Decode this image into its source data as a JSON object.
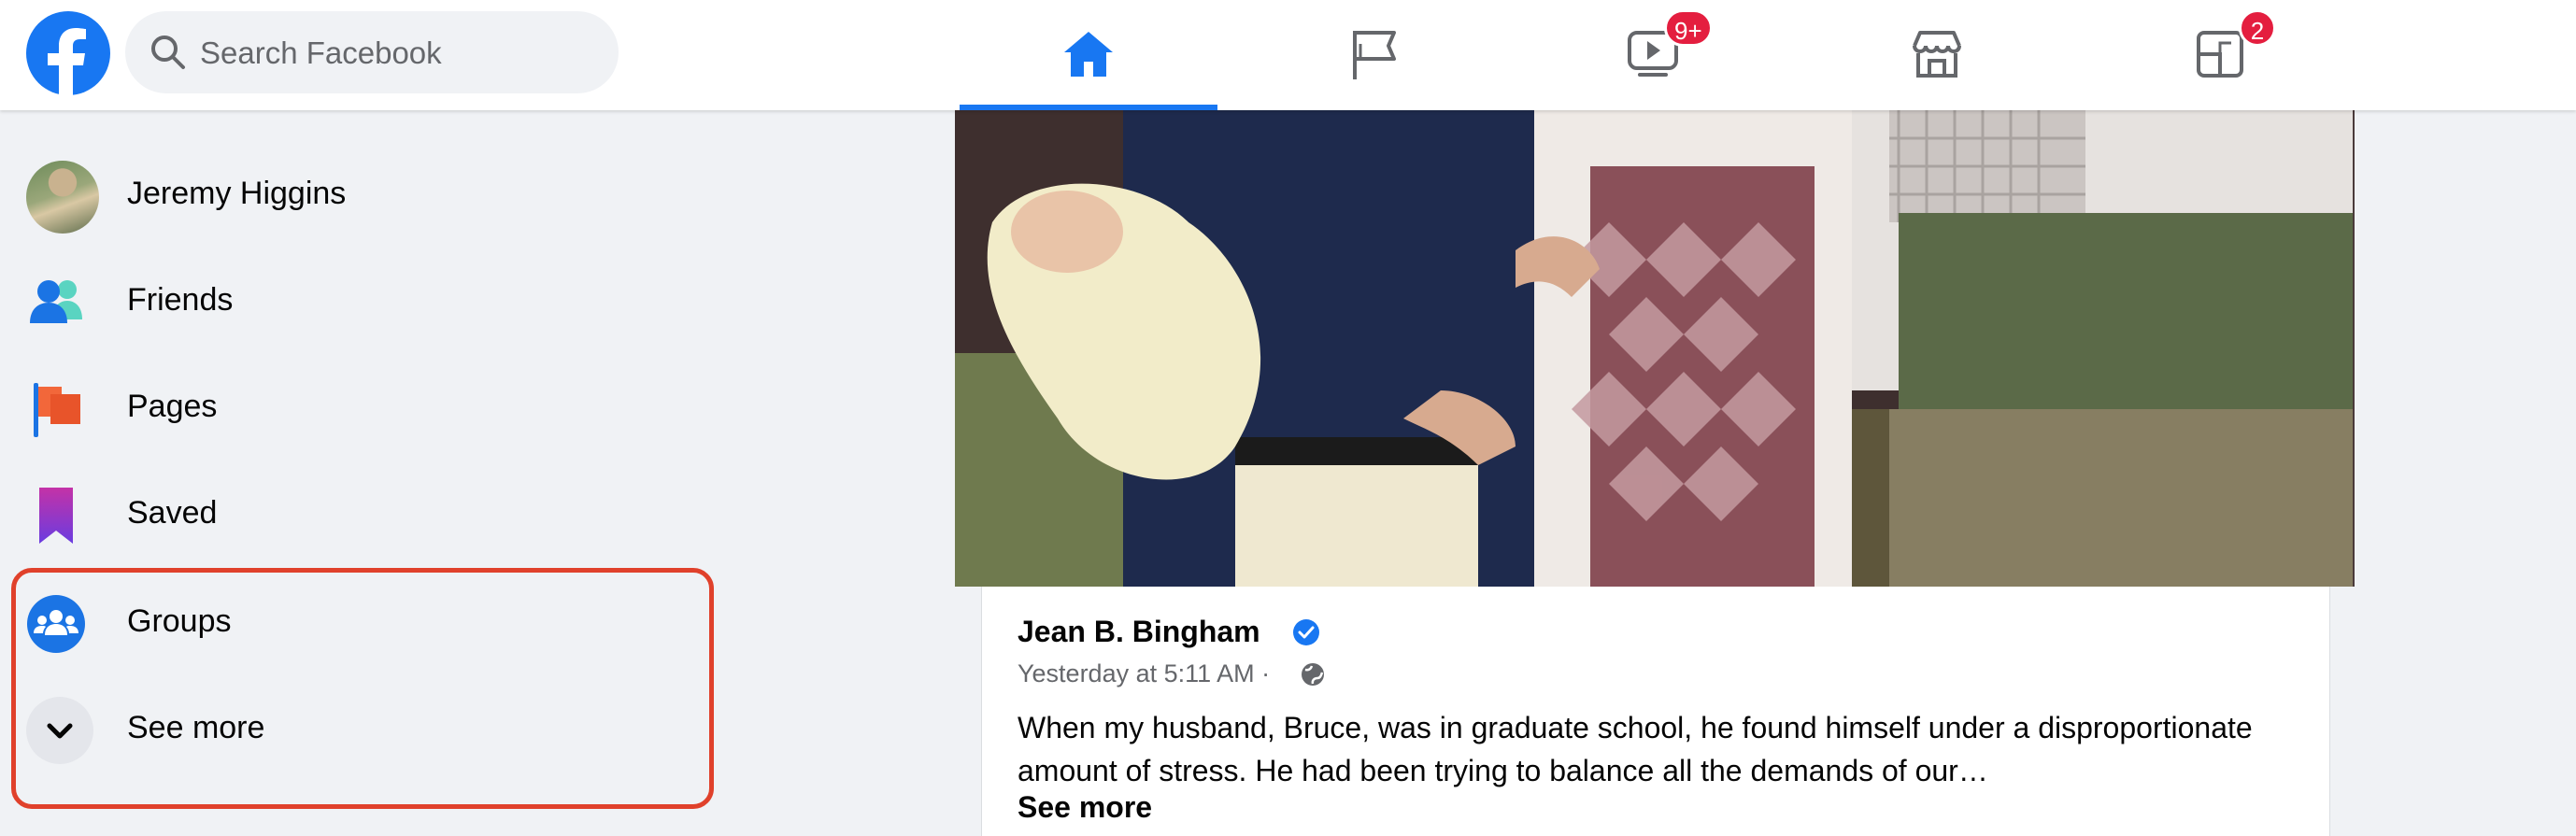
{
  "header": {
    "search_placeholder": "Search Facebook",
    "tabs": [
      {
        "name": "home",
        "active": true,
        "badge": ""
      },
      {
        "name": "pages",
        "active": false,
        "badge": ""
      },
      {
        "name": "watch",
        "active": false,
        "badge": "9+"
      },
      {
        "name": "marketplace",
        "active": false,
        "badge": ""
      },
      {
        "name": "gaming",
        "active": false,
        "badge": "2"
      }
    ]
  },
  "sidebar": {
    "items": [
      {
        "label": "Jeremy Higgins",
        "icon": "avatar"
      },
      {
        "label": "Friends",
        "icon": "friends-icon"
      },
      {
        "label": "Pages",
        "icon": "pages-flag-icon"
      },
      {
        "label": "Saved",
        "icon": "bookmark-icon"
      },
      {
        "label": "Groups",
        "icon": "groups-icon"
      },
      {
        "label": "See more",
        "icon": "chevron-down-icon"
      }
    ]
  },
  "post": {
    "author": "Jean B. Bingham",
    "timestamp": "Yesterday at 5:11 AM ·",
    "text": "When my husband, Bruce, was in graduate school, he found himself under a disproportionate amount of stress. He had been trying to balance all the demands of our…",
    "see_more": "See more"
  },
  "colors": {
    "brand": "#1877f2",
    "badge": "#e41e3f",
    "highlight": "#e0412b",
    "background": "#f0f2f5"
  }
}
